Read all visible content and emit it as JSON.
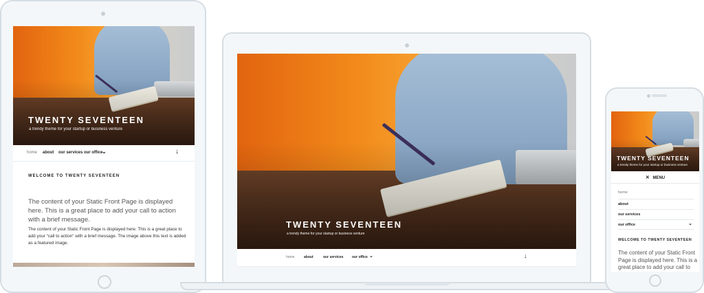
{
  "site": {
    "title": "TWENTY SEVENTEEN",
    "tagline": "a trendy theme for your startup or business venture"
  },
  "nav": {
    "home": "home",
    "about": "about",
    "services": "our services",
    "office": "our office",
    "dropdown_glyph": "⌄",
    "down_arrow_glyph": "↓"
  },
  "mobile_nav": {
    "menu_glyph": "✕",
    "menu_label": "MENU",
    "items": [
      "home",
      "about",
      "our services",
      "our office"
    ],
    "expand_glyph": "⌄"
  },
  "content": {
    "heading": "WELCOME TO TWENTY SEVENTEEN",
    "lead": "The content of your Static Front Page is displayed here. This is a great place to add your call to action with a brief message.",
    "body": "The content of your Static Front Page is displayed here. This is a great place to add your “call to action” with a brief message. The image above this text is added as a featured image.",
    "mobile_lead": "The content of your Static Front Page is displayed here. This is a great place to add your call to action"
  },
  "colors": {
    "accent_orange": "#f28a1a",
    "device_frame": "#f4f7f9",
    "device_border": "#d5dde3"
  }
}
